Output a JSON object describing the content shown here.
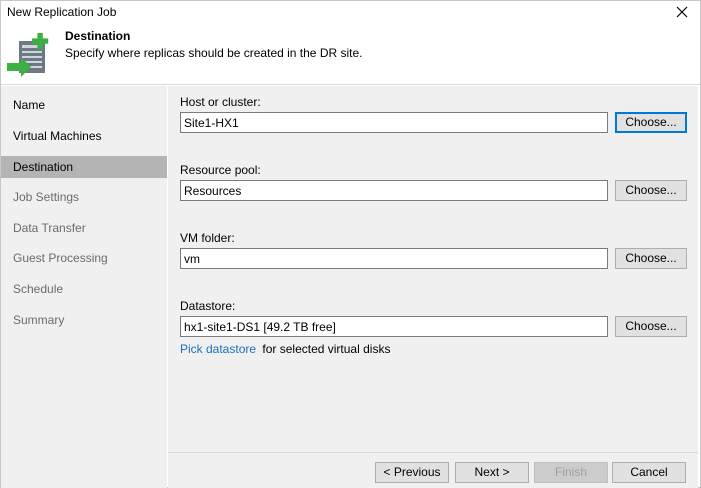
{
  "window": {
    "title": "New Replication Job"
  },
  "header": {
    "title": "Destination",
    "subtitle": "Specify where replicas should be created in the DR site.",
    "icon": "destination-wizard-icon"
  },
  "sidebar": {
    "items": [
      {
        "label": "Name",
        "state": "done"
      },
      {
        "label": "Virtual Machines",
        "state": "done"
      },
      {
        "label": "Destination",
        "state": "active"
      },
      {
        "label": "Job Settings",
        "state": "pending"
      },
      {
        "label": "Data Transfer",
        "state": "pending"
      },
      {
        "label": "Guest Processing",
        "state": "pending"
      },
      {
        "label": "Schedule",
        "state": "pending"
      },
      {
        "label": "Summary",
        "state": "pending"
      }
    ]
  },
  "form": {
    "host": {
      "label": "Host or cluster:",
      "value": "Site1-HX1",
      "button": "Choose..."
    },
    "pool": {
      "label": "Resource pool:",
      "value": "Resources",
      "button": "Choose..."
    },
    "folder": {
      "label": "VM folder:",
      "value": "vm",
      "button": "Choose..."
    },
    "datastore": {
      "label": "Datastore:",
      "value": "hx1-site1-DS1 [49.2 TB free]",
      "button": "Choose..."
    },
    "pick_link": "Pick datastore",
    "pick_suffix": "for selected virtual disks"
  },
  "footer": {
    "previous": "< Previous",
    "next": "Next >",
    "finish": "Finish",
    "cancel": "Cancel"
  },
  "colors": {
    "link": "#1c6fbf",
    "accent_green": "#3cb043",
    "selected_nav": "#b4b4b4"
  }
}
